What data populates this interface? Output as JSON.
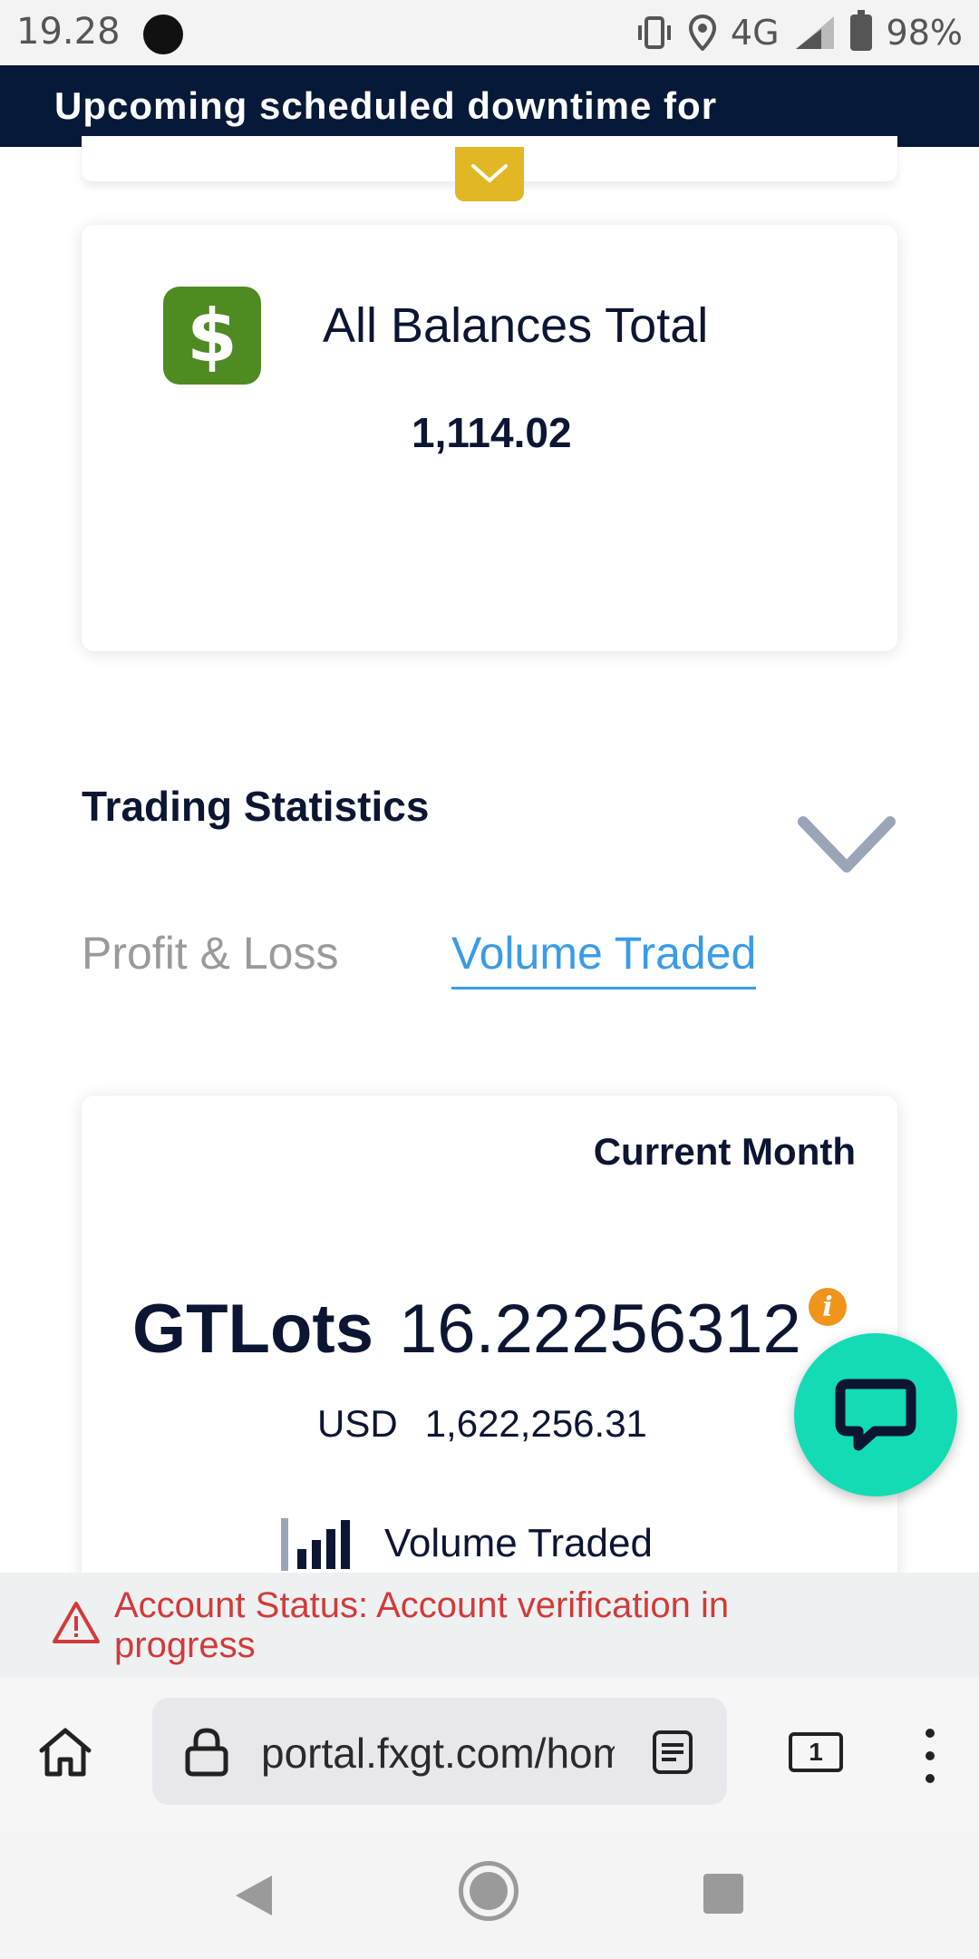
{
  "status_bar": {
    "time": "19.28",
    "network": "4G",
    "battery": "98%"
  },
  "banner": {
    "text": "Upcoming scheduled downtime for"
  },
  "balance_card": {
    "icon": "dollar-icon",
    "icon_glyph": "$",
    "title": "All Balances Total",
    "value": "1,114.02"
  },
  "trading_statistics": {
    "title": "Trading Statistics",
    "tabs": [
      {
        "label": "Profit & Loss",
        "active": false
      },
      {
        "label": "Volume Traded",
        "active": true
      }
    ],
    "card": {
      "period": "Current Month",
      "lots_label": "GTLots",
      "lots_value": "16.22256312",
      "currency": "USD",
      "currency_value": "1,622,256.31",
      "metric_label": "Volume Traded"
    }
  },
  "account_status": {
    "text": "Account Status: Account verification in progress"
  },
  "browser": {
    "url": "portal.fxgt.com/home",
    "tab_count": "1"
  },
  "colors": {
    "banner_bg": "#061938",
    "accent_blue": "#3a9be8",
    "dollar_green": "#4e8b23",
    "chat_teal": "#13dbb4",
    "warning_red": "#d23a3a",
    "toggle_yellow": "#e1b726"
  }
}
